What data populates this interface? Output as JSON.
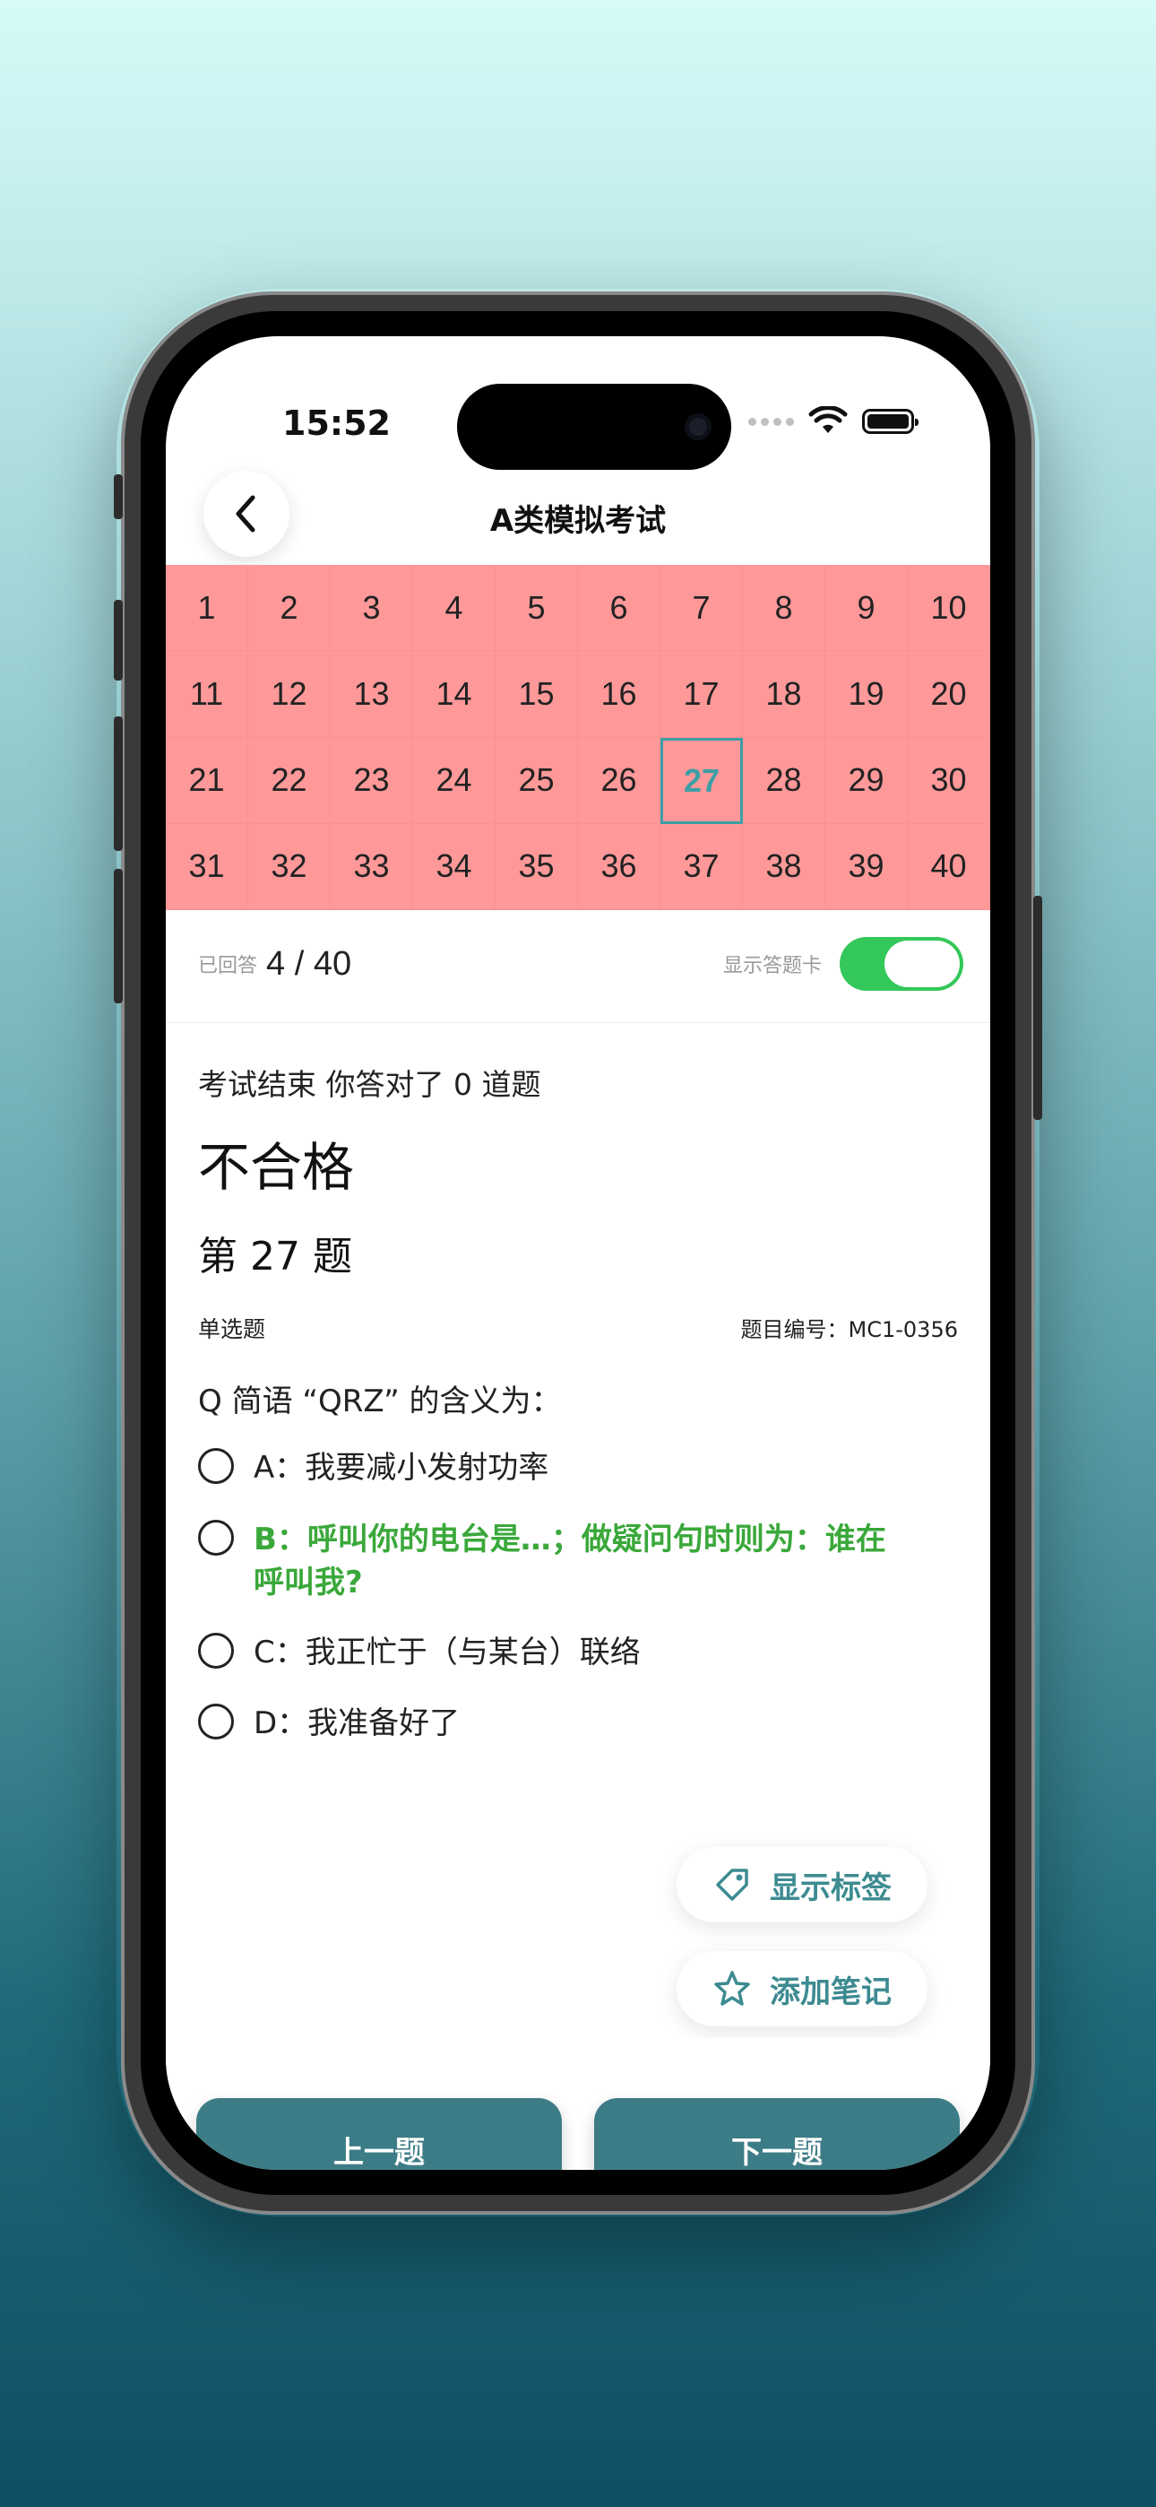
{
  "status_bar": {
    "time": "15:52"
  },
  "nav": {
    "title": "A类模拟考试",
    "back_icon": "chevron-left-icon"
  },
  "answer_card": {
    "numbers": [
      "1",
      "2",
      "3",
      "4",
      "5",
      "6",
      "7",
      "8",
      "9",
      "10",
      "11",
      "12",
      "13",
      "14",
      "15",
      "16",
      "17",
      "18",
      "19",
      "20",
      "21",
      "22",
      "23",
      "24",
      "25",
      "26",
      "27",
      "28",
      "29",
      "30",
      "31",
      "32",
      "33",
      "34",
      "35",
      "36",
      "37",
      "38",
      "39",
      "40"
    ],
    "current": "27",
    "cell_color": "#ff9999",
    "current_color": "#3d9ea5"
  },
  "progress": {
    "answered_label": "已回答",
    "answered_count": "4 / 40",
    "show_card_label": "显示答题卡",
    "show_card_on": true
  },
  "result": {
    "summary": "考试结束 你答对了 0 道题",
    "verdict": "不合格"
  },
  "question": {
    "number_label": "第 27 题",
    "type": "单选题",
    "code": "题目编号：MC1-0356",
    "text": "Q 简语 “QRZ” 的含义为：",
    "options": [
      {
        "text": "A：我要减小发射功率",
        "correct": false
      },
      {
        "text": "B：呼叫你的电台是…；做疑问句时则为：谁在呼叫我?",
        "correct": true
      },
      {
        "text": "C：我正忙于（与某台）联络",
        "correct": false
      },
      {
        "text": "D：我准备好了",
        "correct": false
      }
    ]
  },
  "actions": {
    "show_tags": "显示标签",
    "show_tags_icon": "tag-icon",
    "add_note": "添加笔记",
    "add_note_icon": "star-icon",
    "prev": "上一题",
    "next": "下一题",
    "accent": "#3c7c86"
  }
}
